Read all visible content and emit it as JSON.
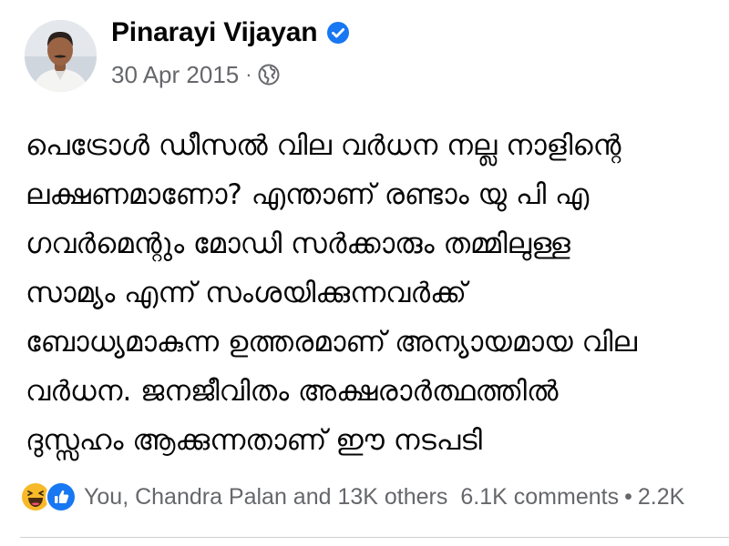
{
  "post": {
    "author": "Pinarayi Vijayan",
    "verified": true,
    "date": "30 Apr 2015",
    "meta_separator": "·",
    "audience_icon": "globe-icon",
    "text_lines": [
      "പെട്രോൾ ഡീസൽ വില വർധന  നല്ല നാളിന്റെ",
      "ലക്ഷണമാണോ? എന്താണ് രണ്ടാം യു പി എ",
      "ഗവർമെന്റും മോഡി സർക്കാരും തമ്മിലുള്ള",
      "സാമ്യം എന്ന് സംശയിക്കുന്നവർക്ക്",
      "ബോധ്യമാകുന്ന ഉത്തരമാണ് അന്യായമായ വില",
      "വർധന.    ജനജീവിതം അക്ഷരാർത്ഥത്തിൽ",
      "ദുസ്സഹം ആക്കുന്നതാണ് ഈ നടപടി"
    ]
  },
  "footer": {
    "reaction_icons": [
      "haha-icon",
      "like-icon"
    ],
    "reaction_names": "You, Chandra Palan and 13K others",
    "comments": "6.1K comments",
    "separator": "•",
    "shares": "2.2K"
  },
  "colors": {
    "verified_blue": "#1877f2",
    "meta_gray": "#65676b",
    "text": "#050505",
    "haha_yellow": "#f7b928",
    "like_blue": "#1877f2"
  }
}
